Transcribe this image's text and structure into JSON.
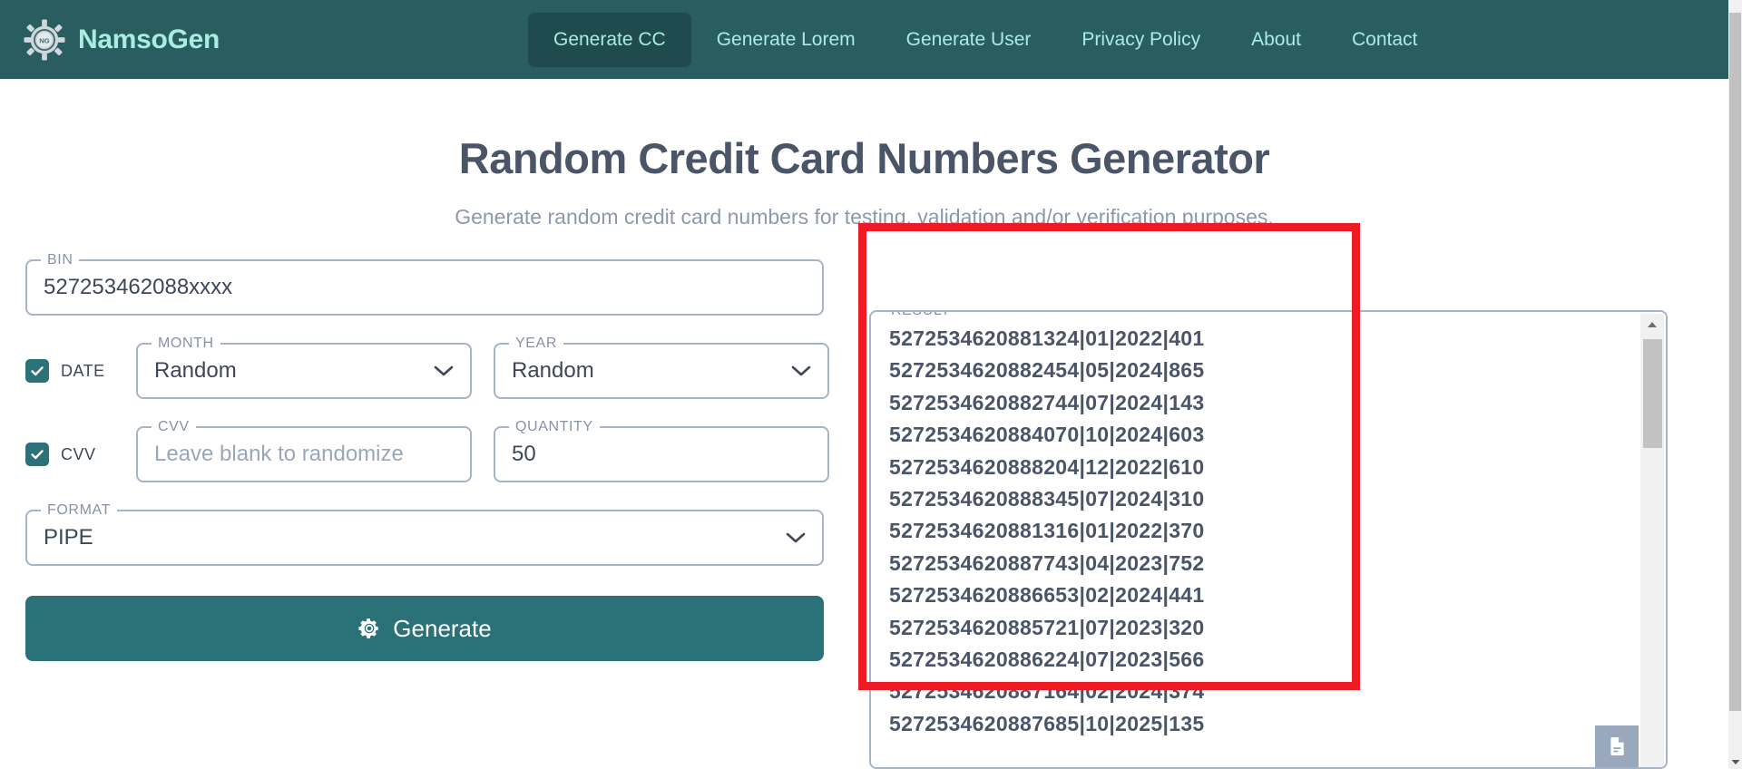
{
  "navbar": {
    "brand": "NamsoGen",
    "logo_initials": "NG",
    "links": [
      {
        "label": "Generate CC",
        "active": true
      },
      {
        "label": "Generate Lorem",
        "active": false
      },
      {
        "label": "Generate User",
        "active": false
      },
      {
        "label": "Privacy Policy",
        "active": false
      },
      {
        "label": "About",
        "active": false
      },
      {
        "label": "Contact",
        "active": false
      }
    ]
  },
  "header": {
    "title": "Random Credit Card Numbers Generator",
    "subtitle": "Generate random credit card numbers for testing, validation and/or verification purposes."
  },
  "form": {
    "bin": {
      "legend": "BIN",
      "value": "527253462088xxxx",
      "placeholder": ""
    },
    "date_checkbox": {
      "label": "DATE",
      "checked": true
    },
    "month": {
      "legend": "MONTH",
      "value": "Random"
    },
    "year": {
      "legend": "YEAR",
      "value": "Random"
    },
    "cvv_checkbox": {
      "label": "CVV",
      "checked": true
    },
    "cvv": {
      "legend": "CVV",
      "value": "",
      "placeholder": "Leave blank to randomize"
    },
    "quantity": {
      "legend": "QUANTITY",
      "value": "50",
      "placeholder": ""
    },
    "format": {
      "legend": "FORMAT",
      "value": "PIPE"
    },
    "generate_button": {
      "label": "Generate",
      "icon": "gear-icon"
    }
  },
  "result": {
    "legend": "RESULT",
    "copy_icon": "copy-document-icon",
    "lines": [
      "5272534620881324|01|2022|401",
      "5272534620882454|05|2024|865",
      "5272534620882744|07|2024|143",
      "5272534620884070|10|2024|603",
      "5272534620888204|12|2022|610",
      "5272534620888345|07|2024|310",
      "5272534620881316|01|2022|370",
      "5272534620887743|04|2023|752",
      "5272534620886653|02|2024|441",
      "5272534620885721|07|2023|320",
      "5272534620886224|07|2023|566",
      "5272534620887164|02|2024|374",
      "5272534620887685|10|2025|135"
    ]
  },
  "colors": {
    "brand_teal": "#2a5d60",
    "accent_teal": "#2a7277",
    "brand_mint": "#a8ece2",
    "text_slate": "#4a5568",
    "border_grey": "#a7b4c7",
    "highlight_red": "#ee1b24"
  }
}
